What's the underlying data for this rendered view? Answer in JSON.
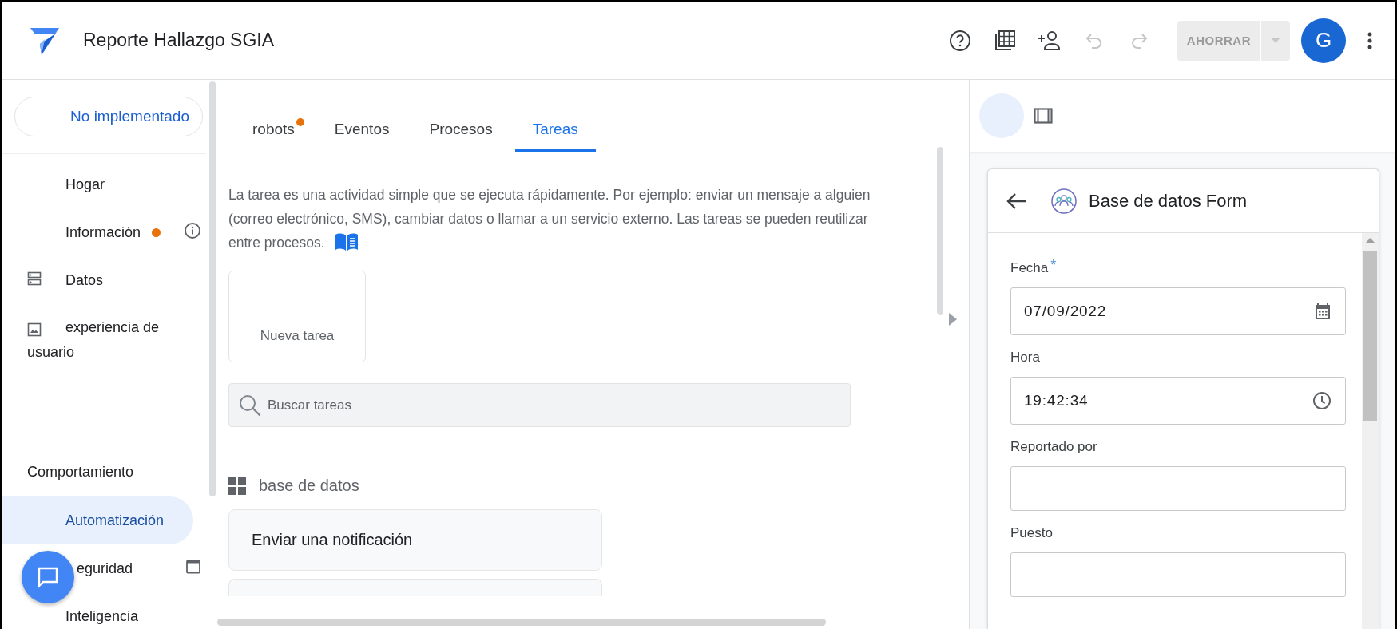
{
  "app": {
    "title": "Reporte Hallazgo SGIA"
  },
  "toolbar": {
    "undo_disabled": true,
    "redo_disabled": true,
    "save_button": {
      "label": "AHORRAR",
      "disabled": true
    },
    "avatar": "G"
  },
  "sidebar": {
    "status": "No implementado",
    "items": [
      {
        "kind": "link",
        "label": "Hogar",
        "selected": false,
        "badge": false
      },
      {
        "kind": "link",
        "label": "Información",
        "selected": false,
        "badge": true
      },
      {
        "kind": "link",
        "label": "Datos",
        "selected": false,
        "badge": false
      },
      {
        "kind": "link",
        "label": "experiencia de usuario",
        "selected": false,
        "badge": false
      },
      {
        "kind": "section",
        "label": "Comportamiento"
      },
      {
        "kind": "link",
        "label": "Automatización",
        "selected": true,
        "badge": false
      },
      {
        "kind": "link",
        "label": "eguridad",
        "selected": false,
        "badge": false
      },
      {
        "kind": "link",
        "label": "Inteligencia",
        "selected": false,
        "badge": false
      }
    ]
  },
  "tabs": [
    {
      "label": "robots",
      "selected": false,
      "badge": true
    },
    {
      "label": "Eventos",
      "selected": false,
      "badge": false
    },
    {
      "label": "Procesos",
      "selected": false,
      "badge": false
    },
    {
      "label": "Tareas",
      "selected": true,
      "badge": false
    }
  ],
  "description": "La tarea es una actividad simple que se ejecuta rápidamente. Por ejemplo: enviar un mensaje a alguien (correo electrónico, SMS), cambiar datos o llamar a un servicio externo. Las tareas se pueden reutilizar entre procesos.",
  "new_task": "Nueva tarea",
  "search": {
    "placeholder": "Buscar tareas"
  },
  "group": {
    "title": "base de datos",
    "tasks": [
      "Enviar una notificación"
    ]
  },
  "form": {
    "title": "Base de datos Form",
    "fields": [
      {
        "kind": "date",
        "label": "Fecha",
        "required_mark": "*",
        "value": "07/09/2022"
      },
      {
        "kind": "time",
        "label": "Hora",
        "value": "19:42:34"
      },
      {
        "kind": "text",
        "label": "Reportado por"
      },
      {
        "kind": "text",
        "label": "Puesto"
      }
    ]
  }
}
